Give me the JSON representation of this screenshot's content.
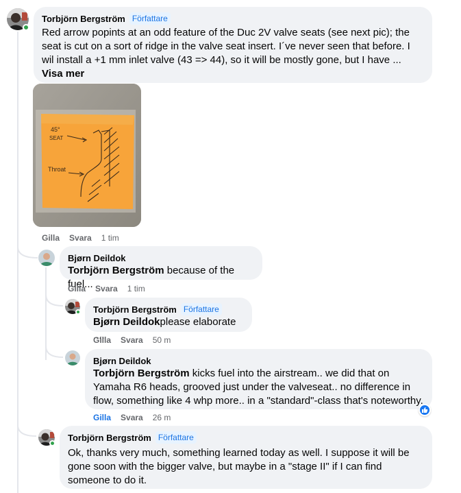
{
  "post": {
    "author": "Torbjörn Bergström",
    "badge": "Författare",
    "text": "Red arrow popints at an odd feature of the Duc 2V valve seats (see next pic); the seat is cut on a sort of ridge in the valve seat insert. I´ve never seen that before. I wil install a +1 mm inlet valve (43 => 44), so it will be mostly gone, but I have ...",
    "more": "Visa mer",
    "like": "Gilla",
    "reply": "Svara",
    "time": "1 tim",
    "photo_labels": {
      "seat": "45°\nSEAT",
      "throat": "Throat"
    }
  },
  "replies": [
    {
      "author": "Bjørn Deildok",
      "mention": "Torbjörn Bergström",
      "text": " because of the fuel...",
      "like": "Gilla",
      "reply": "Svara",
      "time": "1 tim"
    },
    {
      "author": "Torbjörn Bergström",
      "badge": "Författare",
      "mention": "Bjørn Deildok",
      "text": "please elaborate ....",
      "like": "Gilla",
      "reply": "Svara",
      "time": "50 m"
    },
    {
      "author": "Bjørn Deildok",
      "mention": "Torbjörn Bergström",
      "text": " kicks fuel into the airstream.. we did that on Yamaha R6 heads, grooved just under the valveseat.. no difference in flow, something like 4 whp more.. in a \"standard\"-class that's noteworthy.",
      "like": "Gilla",
      "reply": "Svara",
      "time": "26 m",
      "reaction": "like-icon"
    },
    {
      "author": "Torbjörn Bergström",
      "badge": "Författare",
      "text": "Ok, thanks very much, something learned today as well. I suppose it will be gone soon with the bigger valve, but maybe in a \"stage II\" if I can find someone to do it."
    }
  ],
  "colors": {
    "accent": "#1b74e4",
    "bubble": "#f0f2f5",
    "online": "#31a24c",
    "note": "#f7a43a"
  }
}
